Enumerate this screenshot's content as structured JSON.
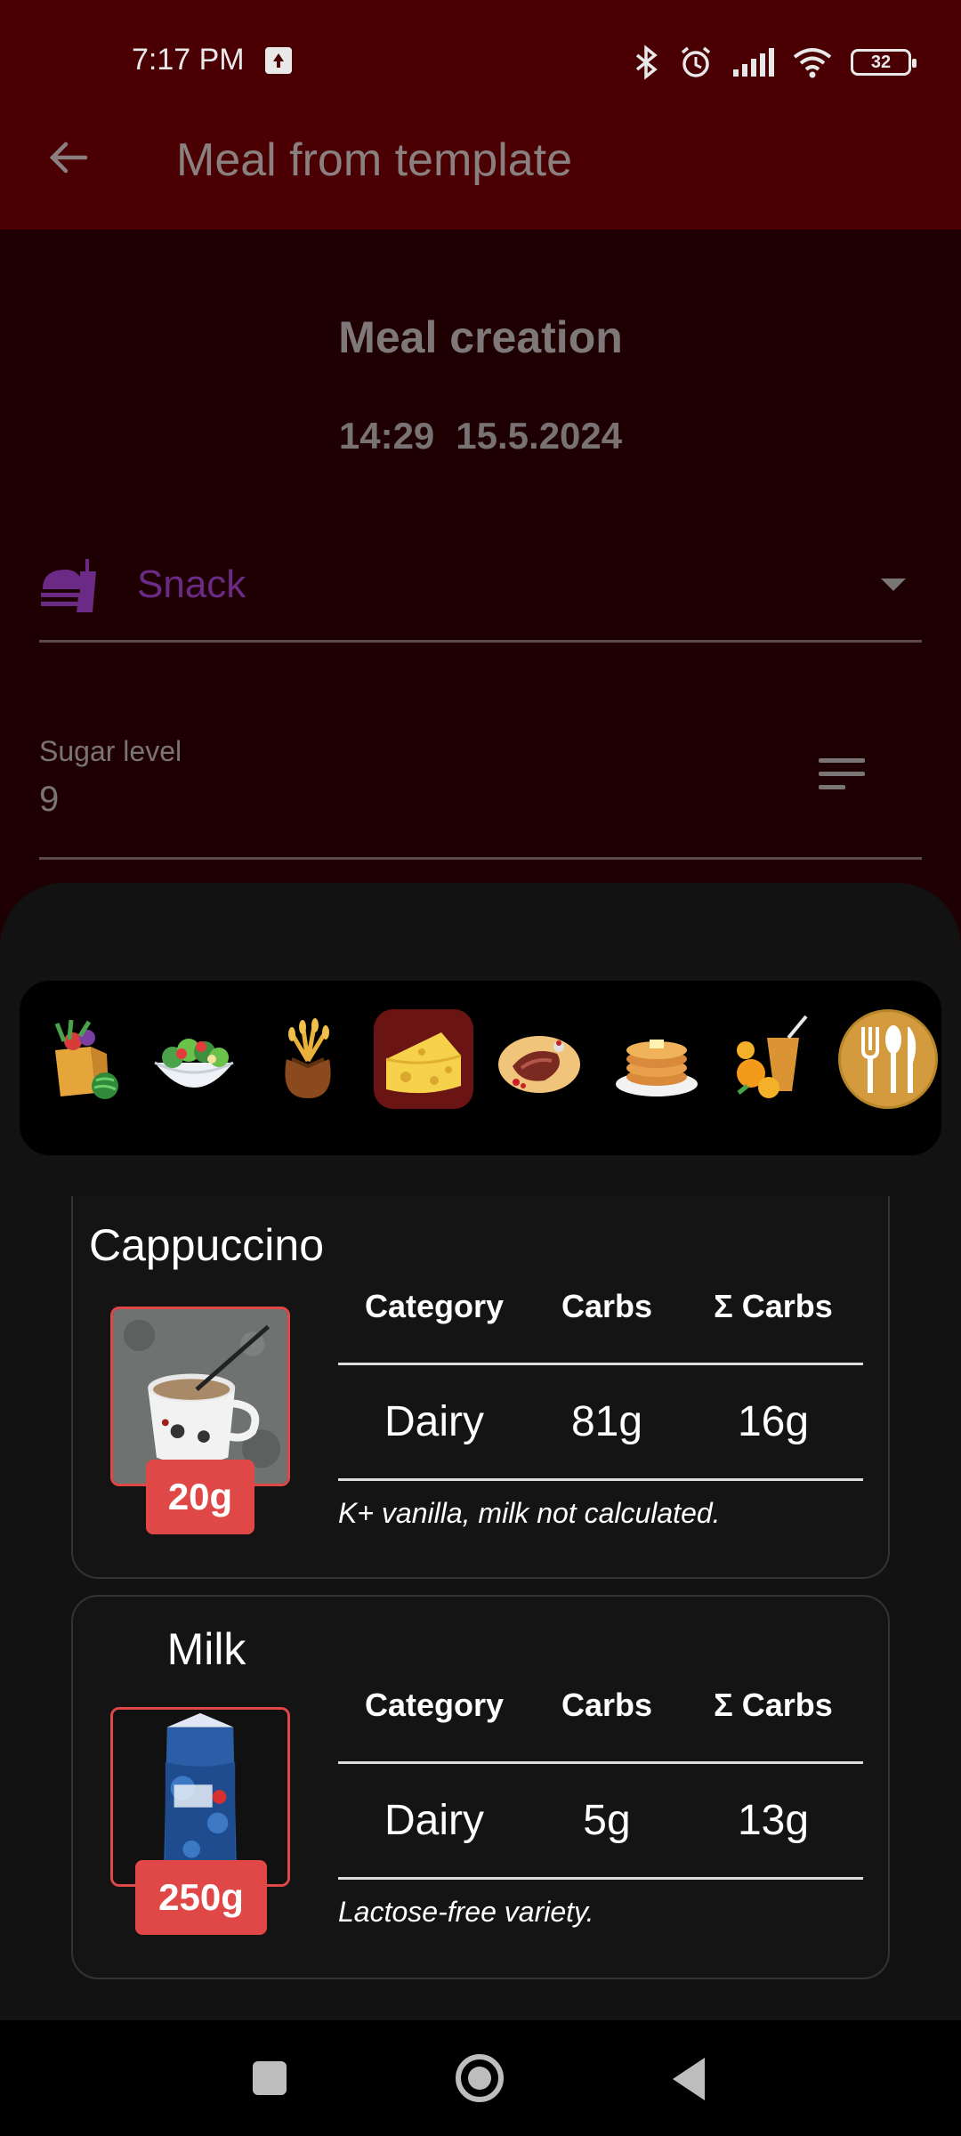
{
  "status_bar": {
    "time": "7:17 PM",
    "battery": "32"
  },
  "app_bar": {
    "title": "Meal from template"
  },
  "form": {
    "heading": "Meal creation",
    "time": "14:29",
    "date": "15.5.2024",
    "meal_type": "Snack",
    "sugar_label": "Sugar level",
    "sugar_value": "9"
  },
  "categories": [
    {
      "icon": "vegetables-bag-icon"
    },
    {
      "icon": "salad-icon"
    },
    {
      "icon": "grain-sack-icon"
    },
    {
      "icon": "cheese-icon",
      "selected": true
    },
    {
      "icon": "meat-icon"
    },
    {
      "icon": "pancakes-icon"
    },
    {
      "icon": "fruit-drink-icon"
    },
    {
      "icon": "cutlery-icon"
    }
  ],
  "table_headers": {
    "category": "Category",
    "carbs": "Carbs",
    "sum_carbs": "Σ Carbs"
  },
  "items": [
    {
      "name": "Cappuccino",
      "amount": "20g",
      "category": "Dairy",
      "carbs": "81g",
      "sum_carbs": "16g",
      "note": "K+ vanilla, milk not calculated."
    },
    {
      "name": "Milk",
      "amount": "250g",
      "category": "Dairy",
      "carbs": "5g",
      "sum_carbs": "13g",
      "note": "Lactose-free variety."
    }
  ],
  "colors": {
    "app_bar": "#4a0003",
    "background": "#1e0003",
    "accent_purple": "#6a2a86",
    "amount_badge": "#e04848"
  }
}
